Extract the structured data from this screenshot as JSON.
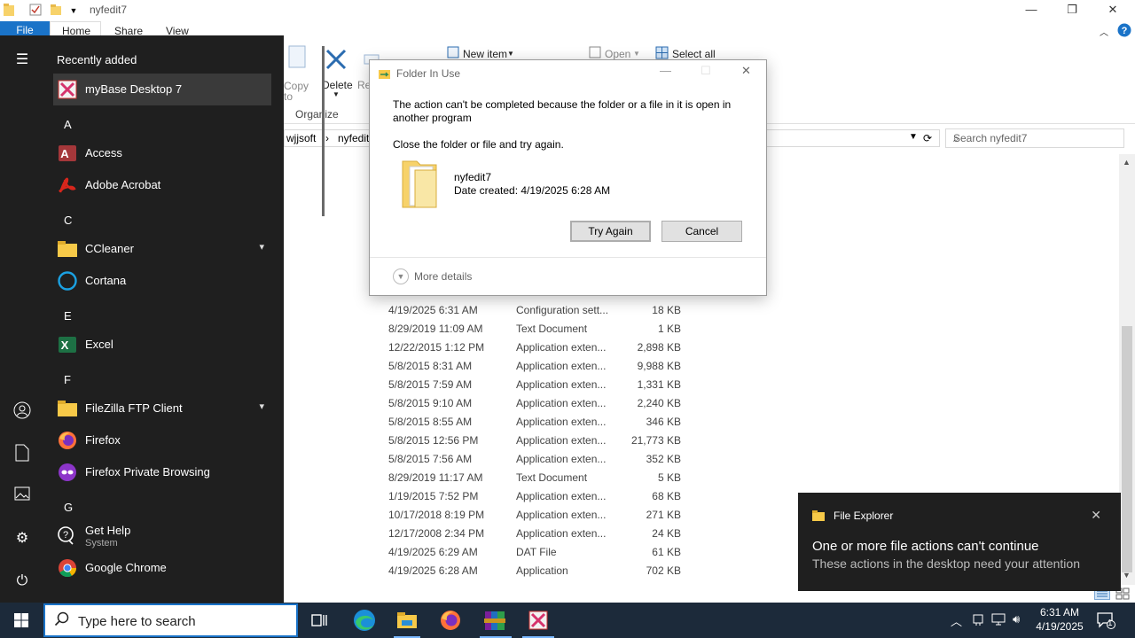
{
  "explorer": {
    "title": "nyfedit7",
    "tabs": {
      "file": "File",
      "home": "Home",
      "share": "Share",
      "view": "View"
    },
    "ribbon": {
      "copy_label": "Copy",
      "copy_sub": "to",
      "delete_label": "Delete",
      "rename_label": "Re",
      "new_item_label": "New item",
      "open_label": "Open",
      "select_all_label": "Select all",
      "organize_group": "Organize"
    },
    "breadcrumb": [
      "wjjsoft",
      "nyfedit7"
    ],
    "search_placeholder": "Search nyfedit7",
    "files": [
      {
        "date": "4/19/2025 6:31 AM",
        "type": "Configuration sett...",
        "size": "18 KB"
      },
      {
        "date": "8/29/2019 11:09 AM",
        "type": "Text Document",
        "size": "1 KB"
      },
      {
        "date": "12/22/2015 1:12 PM",
        "type": "Application exten...",
        "size": "2,898 KB"
      },
      {
        "date": "5/8/2015 8:31 AM",
        "type": "Application exten...",
        "size": "9,988 KB"
      },
      {
        "date": "5/8/2015 7:59 AM",
        "type": "Application exten...",
        "size": "1,331 KB"
      },
      {
        "date": "5/8/2015 9:10 AM",
        "type": "Application exten...",
        "size": "2,240 KB"
      },
      {
        "date": "5/8/2015 8:55 AM",
        "type": "Application exten...",
        "size": "346 KB"
      },
      {
        "date": "5/8/2015 12:56 PM",
        "type": "Application exten...",
        "size": "21,773 KB"
      },
      {
        "date": "5/8/2015 7:56 AM",
        "type": "Application exten...",
        "size": "352 KB"
      },
      {
        "date": "8/29/2019 11:17 AM",
        "type": "Text Document",
        "size": "5 KB"
      },
      {
        "date": "1/19/2015 7:52 PM",
        "type": "Application exten...",
        "size": "68 KB"
      },
      {
        "date": "10/17/2018 8:19 PM",
        "type": "Application exten...",
        "size": "271 KB"
      },
      {
        "date": "12/17/2008 2:34 PM",
        "type": "Application exten...",
        "size": "24 KB"
      },
      {
        "date": "4/19/2025 6:29 AM",
        "type": "DAT File",
        "size": "61 KB"
      },
      {
        "date": "4/19/2025 6:28 AM",
        "type": "Application",
        "size": "702 KB"
      }
    ]
  },
  "start_menu": {
    "heading": "Recently added",
    "recent": {
      "name": "myBase Desktop 7"
    },
    "letters": {
      "a": "A",
      "c": "C",
      "e": "E",
      "f": "F",
      "g": "G"
    },
    "apps": {
      "access": "Access",
      "acrobat": "Adobe Acrobat",
      "ccleaner": "CCleaner",
      "cortana": "Cortana",
      "excel": "Excel",
      "filezilla": "FileZilla FTP Client",
      "firefox": "Firefox",
      "firefox_private": "Firefox Private Browsing",
      "gethelp": "Get Help",
      "gethelp_sub": "System",
      "chrome": "Google Chrome"
    },
    "colors": {
      "bg": "#1f1f1f",
      "highlight": "#3a3a3a"
    }
  },
  "dialog": {
    "title": "Folder In Use",
    "message": "The action can't be completed because the folder or a file in it is open in another program",
    "instruction": "Close the folder or file and try again.",
    "file_name": "nyfedit7",
    "date_created": "Date created: 4/19/2025 6:28 AM",
    "try_again": "Try Again",
    "cancel": "Cancel",
    "more_details": "More details"
  },
  "toast": {
    "app": "File Explorer",
    "headline": "One or more file actions can't continue",
    "body": "These actions in the desktop need your attention"
  },
  "taskbar": {
    "search_placeholder": "Type here to search",
    "time": "6:31 AM",
    "date": "4/19/2025",
    "notification_count": "1",
    "accent": "#1a73c8"
  }
}
